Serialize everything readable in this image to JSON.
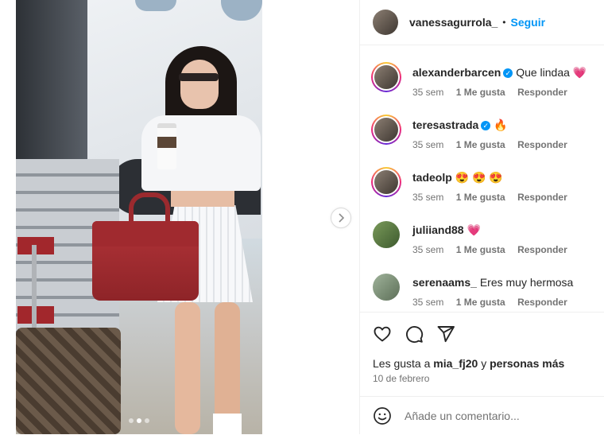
{
  "post": {
    "author": "vanessagurrola_",
    "separator": "•",
    "follow_label": "Seguir",
    "carousel": {
      "slide_count": 3,
      "active_index": 1
    }
  },
  "comments": [
    {
      "user": "alexanderbarcen",
      "verified": true,
      "text": "Que lindaa",
      "emoji": "💗",
      "time": "35 sem",
      "likes": "1 Me gusta",
      "reply": "Responder",
      "story_ring": true
    },
    {
      "user": "teresastrada",
      "verified": true,
      "text": "",
      "emoji": "🔥",
      "time": "35 sem",
      "likes": "1 Me gusta",
      "reply": "Responder",
      "story_ring": true
    },
    {
      "user": "tadeolp",
      "verified": false,
      "text": "",
      "emoji": "😍 😍 😍",
      "time": "35 sem",
      "likes": "1 Me gusta",
      "reply": "Responder",
      "story_ring": true
    },
    {
      "user": "juliiand88",
      "verified": false,
      "text": "",
      "emoji": "💗",
      "time": "35 sem",
      "likes": "1 Me gusta",
      "reply": "Responder",
      "story_ring": false
    },
    {
      "user": "serenaams_",
      "verified": false,
      "text": "Eres muy hermosa",
      "emoji": "",
      "time": "35 sem",
      "likes": "1 Me gusta",
      "reply": "Responder",
      "story_ring": false
    }
  ],
  "actions": {
    "icons": [
      "heart-icon",
      "comment-icon",
      "share-icon"
    ]
  },
  "likes_line": {
    "prefix": "Les gusta a",
    "user": "mia_fj20",
    "conj": "y",
    "others": "personas más"
  },
  "date": "10 de febrero",
  "add_comment": {
    "placeholder": "Añade un comentario..."
  },
  "colors": {
    "accent": "#0095f6",
    "text": "#262626",
    "muted": "#737373",
    "border": "#efefef"
  }
}
